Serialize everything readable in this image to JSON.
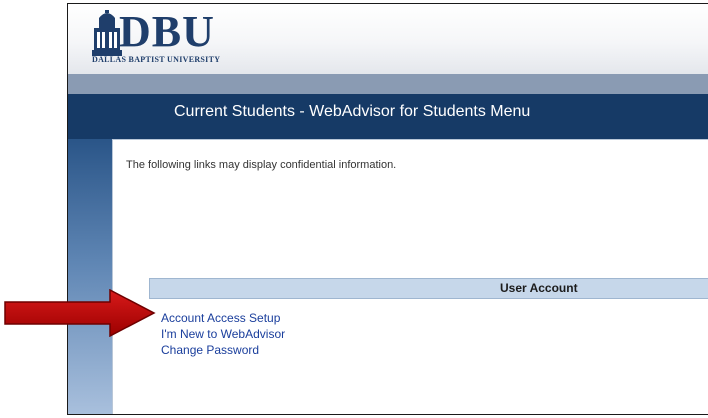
{
  "logo": {
    "wordmark": "DBU",
    "tagline": "DALLAS BAPTIST UNIVERSITY",
    "icon": "university-building-icon"
  },
  "page": {
    "title": "Current Students - WebAdvisor for Students Menu",
    "notice": "The following links may display confidential information."
  },
  "user_account": {
    "heading": "User Account",
    "links": [
      {
        "label": "Account Access Setup"
      },
      {
        "label": "I'm New to WebAdvisor"
      },
      {
        "label": "Change Password"
      }
    ]
  },
  "annotation": {
    "icon": "right-arrow-icon",
    "color": "#c00000"
  },
  "colors": {
    "brand_navy": "#163a66",
    "header_band": "#8a9bb3",
    "link": "#1a3e9c",
    "section_header": "#c6d7ea"
  }
}
